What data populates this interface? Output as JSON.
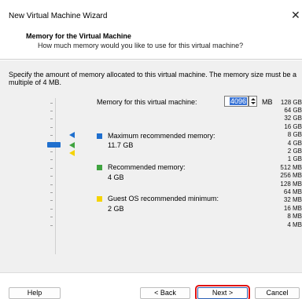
{
  "window": {
    "title": "New Virtual Machine Wizard",
    "close_glyph": "✕"
  },
  "header": {
    "title": "Memory for the Virtual Machine",
    "subtitle": "How much memory would you like to use for this virtual machine?"
  },
  "description": "Specify the amount of memory allocated to this virtual machine. The memory size must be a multiple of 4 MB.",
  "scale": {
    "labels": [
      "128 GB",
      "64 GB",
      "32 GB",
      "16 GB",
      "8 GB",
      "4 GB",
      "2 GB",
      "1 GB",
      "512 MB",
      "256 MB",
      "128 MB",
      "64 MB",
      "32 MB",
      "16 MB",
      "8 MB",
      "4 MB"
    ],
    "selected": "4 GB"
  },
  "memory": {
    "label": "Memory for this virtual machine:",
    "value": "4096",
    "unit": "MB"
  },
  "legend": {
    "max": {
      "title": "Maximum recommended memory:",
      "value": "11.7 GB",
      "color": "#1f6fce"
    },
    "recommended": {
      "title": "Recommended memory:",
      "value": "4 GB",
      "color": "#3fa33f"
    },
    "minimum": {
      "title": "Guest OS recommended minimum:",
      "value": "2 GB",
      "color": "#f5d300"
    }
  },
  "buttons": {
    "help": "Help",
    "back": "< Back",
    "next": "Next >",
    "cancel": "Cancel"
  }
}
